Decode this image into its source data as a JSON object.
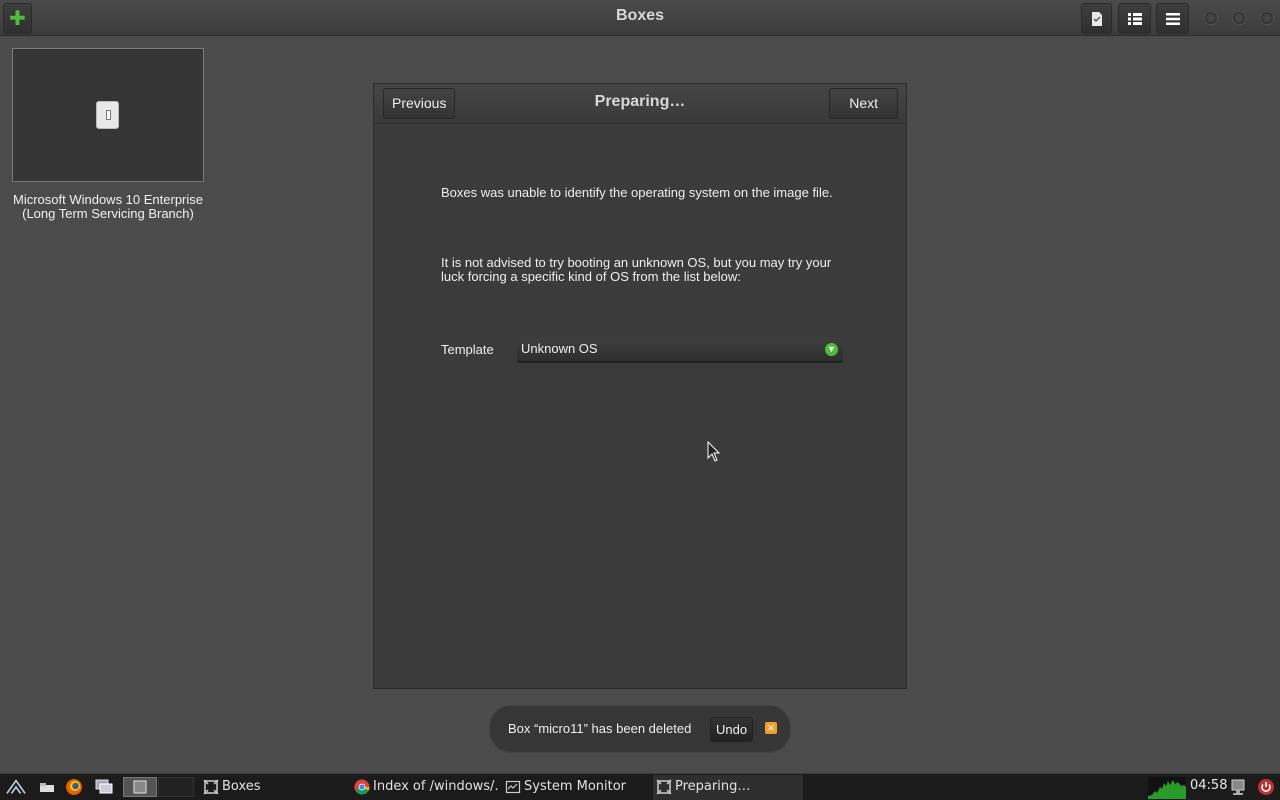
{
  "window": {
    "title": "Boxes"
  },
  "header": {
    "new_icon": "plus-icon",
    "buttons": [
      "select-icon",
      "list-view-icon",
      "menu-icon"
    ]
  },
  "collection": {
    "items": [
      {
        "label": "Microsoft Windows 10 Enterprise (Long Term Servicing Branch)"
      }
    ]
  },
  "wizard": {
    "previous_label": "Previous",
    "title": "Preparing…",
    "next_label": "Next",
    "message1": "Boxes was unable to identify the operating system on the image file.",
    "message2": "It is not advised to try booting an unknown OS, but you may try your luck forcing a specific kind of OS from the list below:",
    "template_label": "Template",
    "template_value": "Unknown OS"
  },
  "notification": {
    "text": "Box “micro11” has been deleted",
    "undo_label": "Undo"
  },
  "taskbar": {
    "tasks": [
      {
        "label": "Boxes",
        "icon": "boxes-icon"
      },
      {
        "label": "Index of /windows/…",
        "icon": "chrome-icon"
      },
      {
        "label": "System Monitor",
        "icon": "monitor-icon"
      },
      {
        "label": "Preparing…",
        "icon": "boxes-icon"
      }
    ],
    "clock": "04:58"
  },
  "colors": {
    "background": "#4b4b4b",
    "accent_green": "#4fbf3a",
    "notification_close": "#f0a030",
    "power": "#e04040"
  }
}
